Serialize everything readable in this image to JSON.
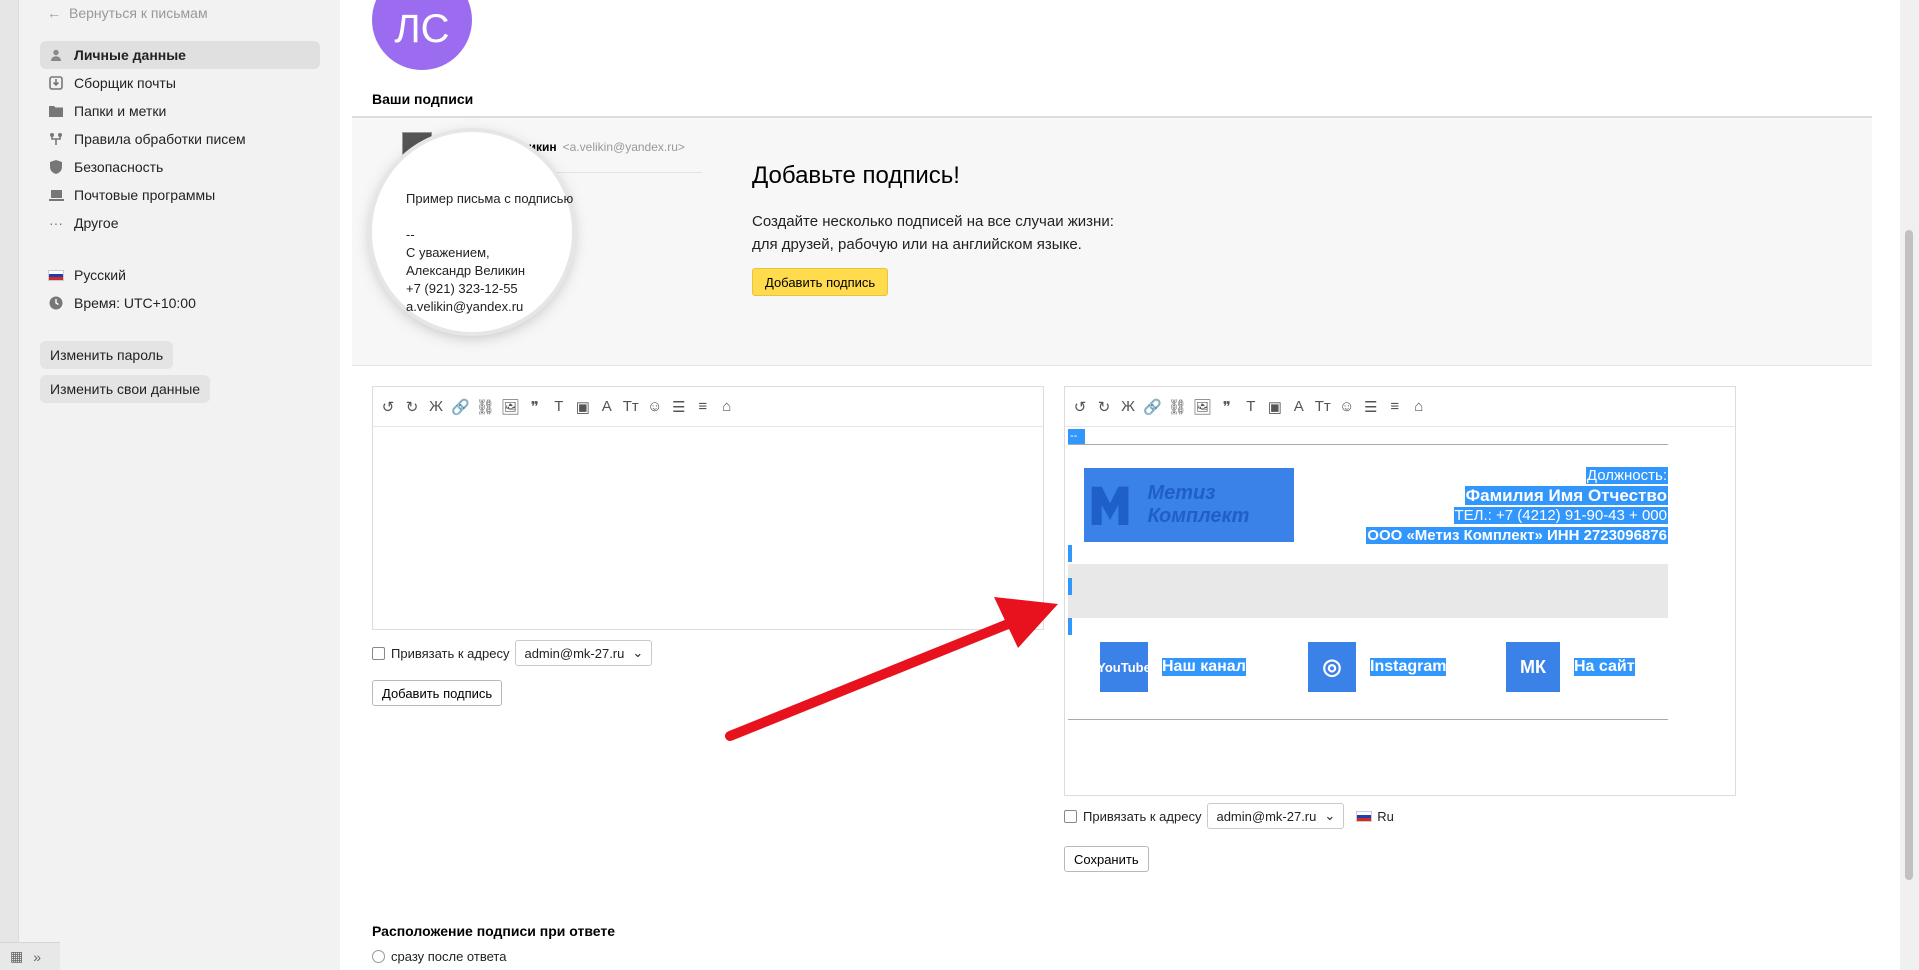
{
  "sidebar": {
    "back_label": "Вернуться к письмам",
    "items": [
      {
        "label": "Личные данные",
        "icon": "person-icon"
      },
      {
        "label": "Сборщик почты",
        "icon": "download-icon"
      },
      {
        "label": "Папки и метки",
        "icon": "folder-icon"
      },
      {
        "label": "Правила обработки писем",
        "icon": "filter-rules-icon"
      },
      {
        "label": "Безопасность",
        "icon": "shield-icon"
      },
      {
        "label": "Почтовые программы",
        "icon": "laptop-icon"
      },
      {
        "label": "Другое",
        "icon": "more-dots-icon"
      }
    ],
    "language": "Русский",
    "time": "Время: UTC+10:00",
    "change_password": "Изменить пароль",
    "change_data": "Изменить свои данные"
  },
  "avatar_initials": "ЛС",
  "signatures_title": "Ваши подписи",
  "promo": {
    "sample_name": "Александр Великин",
    "sample_email": "<a.velikin@yandex.ru>",
    "sample_lines": [
      "Пример письма с подписью",
      "",
      "--",
      "С уважением,",
      "Александр Великин",
      "+7 (921) 323-12-55",
      "a.velikin@yandex.ru"
    ],
    "heading": "Добавьте подпись!",
    "text_line1": "Создайте несколько подписей на все случаи жизни:",
    "text_line2": "для друзей, рабочую или на английском языке.",
    "button": "Добавить подпись"
  },
  "toolbar_tools": [
    "↺",
    "↻",
    "Ж",
    "🔗",
    "⛓",
    "🖼",
    "❞",
    "T",
    "▣",
    "A",
    "Tт",
    "☺",
    "☰",
    "≡",
    "⌂"
  ],
  "editor_left": {
    "bind_label": "Привязать к адресу",
    "bind_value": "admin@mk-27.ru",
    "add_button": "Добавить подпись"
  },
  "editor_right": {
    "dash": "--",
    "logo_text": "Метиз Комплект",
    "position": "Должность:",
    "name": "Фамилия Имя Отчество",
    "phone": "ТЕЛ.: +7 (4212) 91-90-43 + 000",
    "company": "ООО «Метиз Комплект» ИНН 2723096876",
    "social": [
      {
        "icon": "youtube-icon",
        "icon_text": "YouTube",
        "label": "Наш канал"
      },
      {
        "icon": "instagram-icon",
        "icon_text": "◎",
        "label": "Instagram"
      },
      {
        "icon": "company-logo-icon",
        "icon_text": "МК",
        "label": "На сайт"
      }
    ],
    "bind_label": "Привязать к адресу",
    "bind_value": "admin@mk-27.ru",
    "lang": "Ru",
    "save_button": "Сохранить"
  },
  "reply_position": {
    "title": "Расположение подписи при ответе",
    "option1": "сразу после ответа"
  },
  "colors": {
    "accent": "#ffdb4d",
    "selection": "#3297fd",
    "arrow": "#e8121e",
    "avatar": "#9b6cf0"
  }
}
